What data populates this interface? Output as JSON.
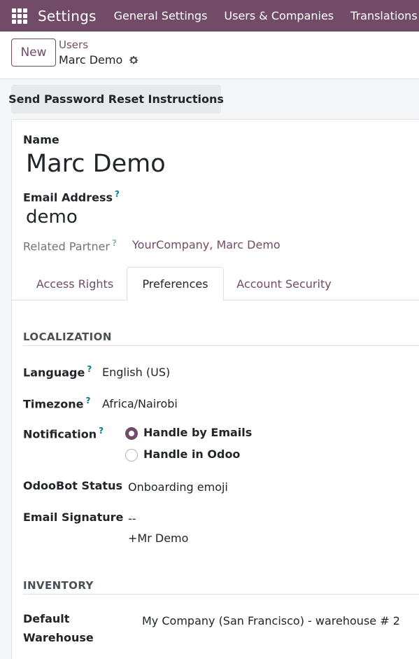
{
  "navbar": {
    "app_name": "Settings",
    "menu": [
      "General Settings",
      "Users & Companies",
      "Translations"
    ]
  },
  "control_panel": {
    "new_label": "New",
    "breadcrumb_parent": "Users",
    "breadcrumb_current": "Marc Demo"
  },
  "actions": {
    "reset_password_label": "Send Password Reset Instructions"
  },
  "form": {
    "name_label": "Name",
    "name_value": "Marc Demo",
    "email_label": "Email Address",
    "email_value": "demo",
    "related_partner_label": "Related Partner",
    "related_partner_value": "YourCompany, Marc Demo",
    "help_marker": "?"
  },
  "tabs": [
    {
      "label": "Access Rights",
      "active": false
    },
    {
      "label": "Preferences",
      "active": true
    },
    {
      "label": "Account Security",
      "active": false
    }
  ],
  "preferences": {
    "localization_title": "LOCALIZATION",
    "language_label": "Language",
    "language_value": "English (US)",
    "timezone_label": "Timezone",
    "timezone_value": "Africa/Nairobi",
    "notification_label": "Notification",
    "notification_options": [
      {
        "label": "Handle by Emails",
        "selected": true
      },
      {
        "label": "Handle in Odoo",
        "selected": false
      }
    ],
    "odoobot_label": "OdooBot Status",
    "odoobot_value": "Onboarding emoji",
    "signature_label": "Email Signature",
    "signature_lines": [
      "--",
      "+Mr Demo"
    ],
    "inventory_title": "INVENTORY",
    "warehouse_label_line1": "Default",
    "warehouse_label_line2": "Warehouse",
    "warehouse_value": "My Company (San Francisco) - warehouse # 2"
  },
  "colors": {
    "brand": "#714b67",
    "help": "#017e84"
  }
}
